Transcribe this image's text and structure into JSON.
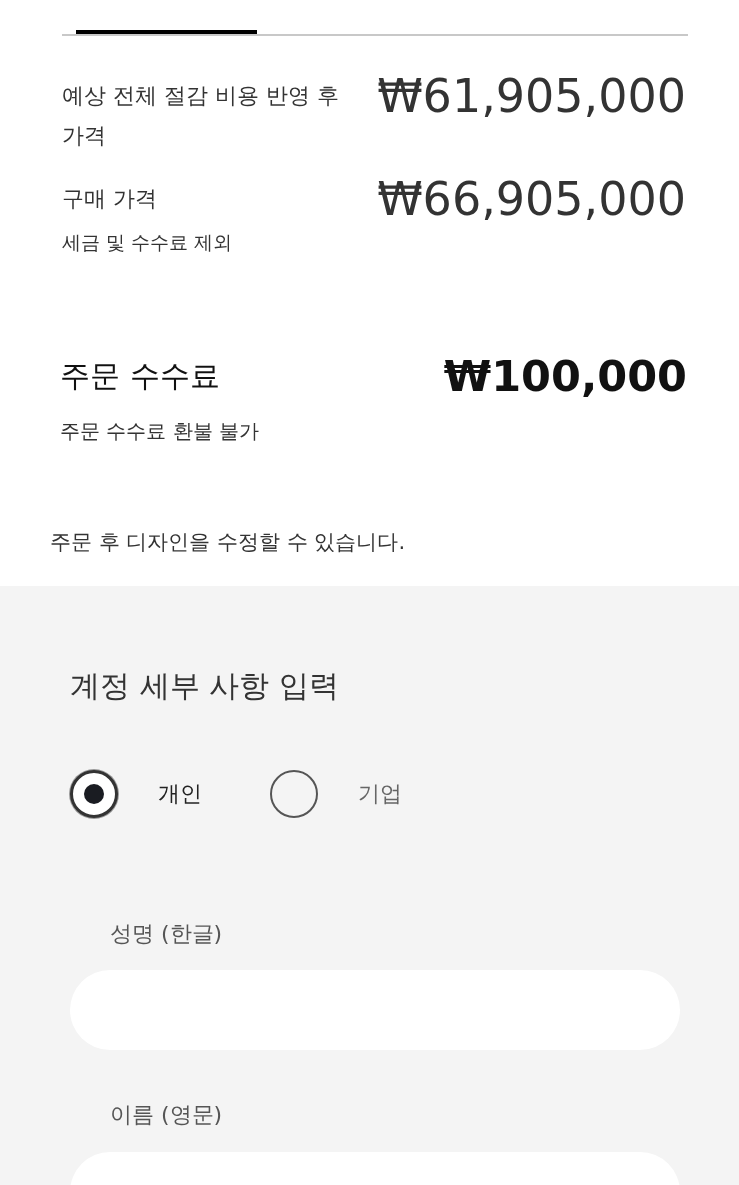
{
  "tabs": [
    {
      "selected": true
    },
    {
      "selected": false
    },
    {
      "selected": false
    }
  ],
  "price_rows": [
    {
      "label": "예상 전체 절감 비용 반영 후 가격",
      "price": "₩61,905,000"
    },
    {
      "label": "구매 가격",
      "note": "세금 및 수수료 제외",
      "price": "₩66,905,000"
    }
  ],
  "order_fee": {
    "label": "주문 수수료",
    "price": "₩100,000",
    "note": "주문 수수료 환불 불가"
  },
  "design_note": "주문 후 디자인을 수정할 수 있습니다.",
  "account": {
    "title": "계정 세부 사항 입력",
    "account_types": [
      {
        "label": "개인",
        "selected": true
      },
      {
        "label": "기업",
        "selected": false
      }
    ],
    "fields": [
      {
        "label": "성명 (한글)"
      },
      {
        "label": "이름 (영문)"
      }
    ]
  }
}
